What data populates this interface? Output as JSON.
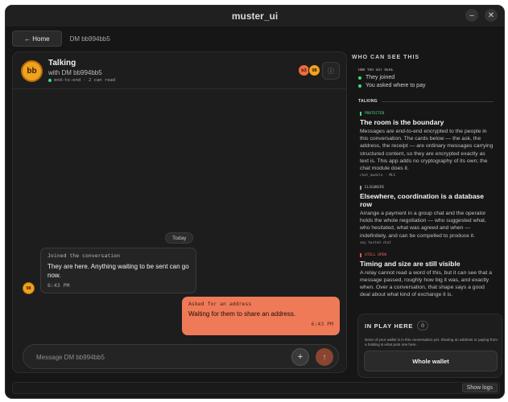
{
  "window": {
    "title": "muster_ui",
    "minimize_icon": "minus-icon",
    "close_icon": "close-icon"
  },
  "nav": {
    "home_label": "← Home",
    "breadcrumb": "DM bb994bb5"
  },
  "chat": {
    "avatar_initials": "bb",
    "title": "Talking",
    "subtitle": "with DM bb994bb5",
    "status": "end-to-end · 2 can read",
    "status_color": "#3ddc84",
    "members": [
      "b3",
      "98"
    ],
    "info_icon": "info-icon",
    "day_divider": "Today",
    "messages": [
      {
        "direction": "in",
        "sender_initials": "98",
        "tag": "Joined the conversation",
        "text": "They are here. Anything waiting to be sent can go now.",
        "time": "6:43 PM"
      },
      {
        "direction": "out",
        "tag": "Asked for an address",
        "text": "Waiting for them to share an address.",
        "time": "6:43 PM"
      }
    ],
    "composer": {
      "placeholder": "Message DM bb994bb5",
      "add_icon": "plus-icon",
      "send_icon": "arrow-up-icon"
    },
    "accent": "#ee7a58"
  },
  "sidebar": {
    "heading": "WHO CAN SEE THIS",
    "how_label": "HOW YOU GOT HERE",
    "how_items": [
      "They joined",
      "You asked where to pay"
    ],
    "talking_label": "TALKING",
    "cards": [
      {
        "tag": "PROTECTED",
        "tag_color": "green",
        "title": "The room is the boundary",
        "body": "Messages are end-to-end encrypted to the people in this conversation. The cards below — the ask, the address, the receipt — are ordinary messages carrying structured content, so they are encrypted exactly as text is. This app adds no cryptography of its own; the chat module does it.",
        "foot": "chat_module · MLS"
      },
      {
        "tag": "ELSEWHERE",
        "tag_color": "grey",
        "title": "Elsewhere, coordination is a database row",
        "body": "Arrange a payment in a group chat and the operator holds the whole negotiation — who suggested what, who hesitated, what was agreed and when — indefinitely, and can be compelled to produce it.",
        "foot": "any hosted chat"
      },
      {
        "tag": "STILL OPEN",
        "tag_color": "red",
        "title": "Timing and size are still visible",
        "body": "A relay cannot read a word of this, but it can see that a message passed, roughly how big it was, and exactly when. Over a conversation, that shape says a good deal about what kind of exchange it is.",
        "foot": ""
      }
    ]
  },
  "in_play": {
    "title": "IN PLAY HERE",
    "count": "0",
    "note": "None of your wallet is in this conversation yet. Sharing an address or paying from a holding is what puts one here.",
    "button": "Whole wallet"
  },
  "footer": {
    "logs_label": "Show logs"
  }
}
